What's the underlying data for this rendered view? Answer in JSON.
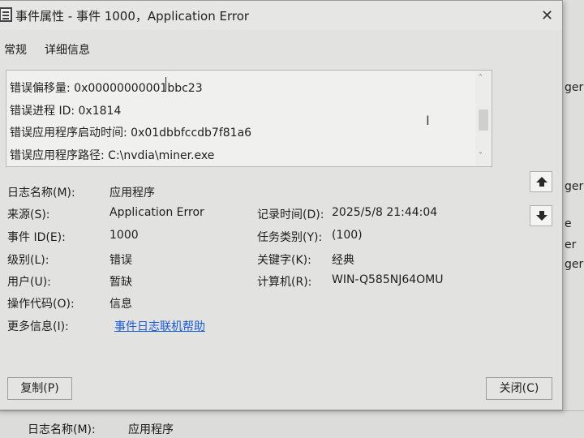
{
  "window": {
    "title": "事件属性 - 事件 1000，Application Error",
    "close_glyph": "✕"
  },
  "tabs": [
    {
      "label": "常规"
    },
    {
      "label": "详细信息"
    }
  ],
  "description_lines": [
    "错误偏移量: 0x00000000001bbc23",
    "错误进程 ID: 0x1814",
    "错误应用程序启动时间: 0x01dbbfccdb7f81a6",
    "错误应用程序路径: C:\\nvdia\\miner.exe"
  ],
  "properties": {
    "log_name": {
      "label": "日志名称(M):",
      "value": "应用程序"
    },
    "source": {
      "label": "来源(S):",
      "value": "Application Error"
    },
    "event_id": {
      "label": "事件 ID(E):",
      "value": "1000"
    },
    "level": {
      "label": "级别(L):",
      "value": "错误"
    },
    "user": {
      "label": "用户(U):",
      "value": "暂缺"
    },
    "opcode": {
      "label": "操作代码(O):",
      "value": "信息"
    },
    "more_info": {
      "label": "更多信息(I):",
      "link": "事件日志联机帮助"
    },
    "logged": {
      "label": "记录时间(D):",
      "value": "2025/5/8 21:44:04"
    },
    "task_category": {
      "label": "任务类别(Y):",
      "value": "(100)"
    },
    "keywords": {
      "label": "关键字(K):",
      "value": "经典"
    },
    "computer": {
      "label": "计算机(R):",
      "value": "WIN-Q585NJ64OMU"
    }
  },
  "buttons": {
    "copy": "复制(P)",
    "close": "关闭(C)"
  },
  "background": {
    "right_fragments": [
      "ger",
      "ger",
      "e",
      "er",
      "ger"
    ],
    "bottom_label": "日志名称(M):",
    "bottom_value": "应用程序"
  },
  "icons": [
    "app-icon",
    "close-icon",
    "arrow-up-icon",
    "arrow-down-icon",
    "text-cursor-icon"
  ],
  "colors": {
    "link": "#1a5bd8"
  }
}
